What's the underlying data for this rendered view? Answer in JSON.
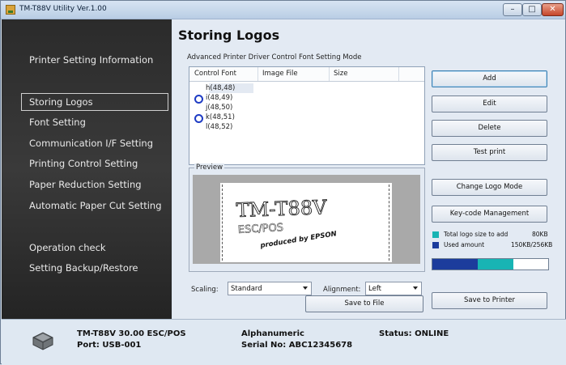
{
  "window": {
    "title": "TM-T88V Utility Ver.1.00",
    "min": "–",
    "max": "□",
    "close": "✕"
  },
  "sidebar": {
    "header": "Printer Setting Information",
    "items": [
      {
        "label": "Storing Logos",
        "active": true
      },
      {
        "label": "Font Setting"
      },
      {
        "label": "Communication I/F Setting"
      },
      {
        "label": "Printing Control Setting"
      },
      {
        "label": "Paper Reduction Setting"
      },
      {
        "label": "Automatic Paper Cut Setting"
      },
      {
        "label": "Operation check"
      },
      {
        "label": "Setting Backup/Restore"
      }
    ]
  },
  "main": {
    "title": "Storing Logos",
    "subtitle": "Advanced Printer Driver Control Font Setting Mode",
    "list": {
      "columns": [
        "Control Font",
        "Image File",
        "Size"
      ],
      "rows": [
        {
          "font": "h(48,48)",
          "marker": false
        },
        {
          "font": "i(48,49)",
          "marker": true
        },
        {
          "font": "j(48,50)",
          "marker": false
        },
        {
          "font": "k(48,51)",
          "marker": true
        },
        {
          "font": "l(48,52)",
          "marker": false
        }
      ]
    },
    "preview": {
      "label": "Preview",
      "logo_line1": "TM-T88V",
      "logo_line2": "ESC/POS",
      "logo_line3": "produced by EPSON"
    },
    "scaling": {
      "label": "Scaling:",
      "value": "Standard"
    },
    "alignment": {
      "label": "Alignment:",
      "value": "Left"
    }
  },
  "buttons": {
    "add": "Add",
    "edit": "Edit",
    "delete": "Delete",
    "test_print": "Test print",
    "change_logo_mode": "Change Logo Mode",
    "key_code": "Key-code Management",
    "save_to_file": "Save to File",
    "save_to_printer": "Save to Printer"
  },
  "usage": {
    "total_label": "Total logo size to add",
    "total_value": "80KB",
    "used_label": "Used amount",
    "used_value": "150KB/256KB",
    "used_fraction": 0.39,
    "add_fraction": 0.31,
    "colors": {
      "used": "#1c3c9c",
      "add": "#18b4b4"
    }
  },
  "status": {
    "model": "TM-T88V 30.00 ESC/POS",
    "port": "Port: USB-001",
    "charset": "Alphanumeric",
    "serial": "Serial No: ABC12345678",
    "status": "Status: ONLINE"
  }
}
